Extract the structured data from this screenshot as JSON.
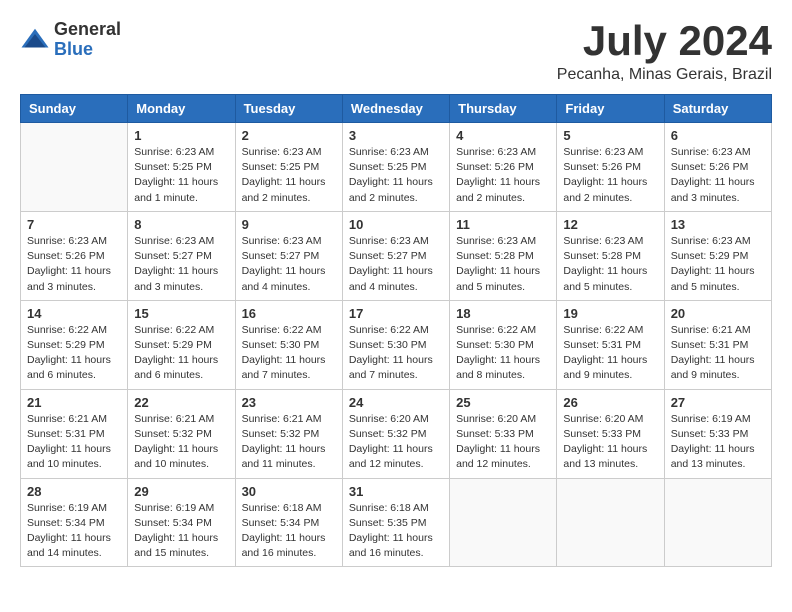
{
  "header": {
    "logo_general": "General",
    "logo_blue": "Blue",
    "month": "July 2024",
    "location": "Pecanha, Minas Gerais, Brazil"
  },
  "days_of_week": [
    "Sunday",
    "Monday",
    "Tuesday",
    "Wednesday",
    "Thursday",
    "Friday",
    "Saturday"
  ],
  "weeks": [
    [
      {
        "day": "",
        "info": ""
      },
      {
        "day": "1",
        "info": "Sunrise: 6:23 AM\nSunset: 5:25 PM\nDaylight: 11 hours\nand 1 minute."
      },
      {
        "day": "2",
        "info": "Sunrise: 6:23 AM\nSunset: 5:25 PM\nDaylight: 11 hours\nand 2 minutes."
      },
      {
        "day": "3",
        "info": "Sunrise: 6:23 AM\nSunset: 5:25 PM\nDaylight: 11 hours\nand 2 minutes."
      },
      {
        "day": "4",
        "info": "Sunrise: 6:23 AM\nSunset: 5:26 PM\nDaylight: 11 hours\nand 2 minutes."
      },
      {
        "day": "5",
        "info": "Sunrise: 6:23 AM\nSunset: 5:26 PM\nDaylight: 11 hours\nand 2 minutes."
      },
      {
        "day": "6",
        "info": "Sunrise: 6:23 AM\nSunset: 5:26 PM\nDaylight: 11 hours\nand 3 minutes."
      }
    ],
    [
      {
        "day": "7",
        "info": "Sunrise: 6:23 AM\nSunset: 5:26 PM\nDaylight: 11 hours\nand 3 minutes."
      },
      {
        "day": "8",
        "info": "Sunrise: 6:23 AM\nSunset: 5:27 PM\nDaylight: 11 hours\nand 3 minutes."
      },
      {
        "day": "9",
        "info": "Sunrise: 6:23 AM\nSunset: 5:27 PM\nDaylight: 11 hours\nand 4 minutes."
      },
      {
        "day": "10",
        "info": "Sunrise: 6:23 AM\nSunset: 5:27 PM\nDaylight: 11 hours\nand 4 minutes."
      },
      {
        "day": "11",
        "info": "Sunrise: 6:23 AM\nSunset: 5:28 PM\nDaylight: 11 hours\nand 5 minutes."
      },
      {
        "day": "12",
        "info": "Sunrise: 6:23 AM\nSunset: 5:28 PM\nDaylight: 11 hours\nand 5 minutes."
      },
      {
        "day": "13",
        "info": "Sunrise: 6:23 AM\nSunset: 5:29 PM\nDaylight: 11 hours\nand 5 minutes."
      }
    ],
    [
      {
        "day": "14",
        "info": "Sunrise: 6:22 AM\nSunset: 5:29 PM\nDaylight: 11 hours\nand 6 minutes."
      },
      {
        "day": "15",
        "info": "Sunrise: 6:22 AM\nSunset: 5:29 PM\nDaylight: 11 hours\nand 6 minutes."
      },
      {
        "day": "16",
        "info": "Sunrise: 6:22 AM\nSunset: 5:30 PM\nDaylight: 11 hours\nand 7 minutes."
      },
      {
        "day": "17",
        "info": "Sunrise: 6:22 AM\nSunset: 5:30 PM\nDaylight: 11 hours\nand 7 minutes."
      },
      {
        "day": "18",
        "info": "Sunrise: 6:22 AM\nSunset: 5:30 PM\nDaylight: 11 hours\nand 8 minutes."
      },
      {
        "day": "19",
        "info": "Sunrise: 6:22 AM\nSunset: 5:31 PM\nDaylight: 11 hours\nand 9 minutes."
      },
      {
        "day": "20",
        "info": "Sunrise: 6:21 AM\nSunset: 5:31 PM\nDaylight: 11 hours\nand 9 minutes."
      }
    ],
    [
      {
        "day": "21",
        "info": "Sunrise: 6:21 AM\nSunset: 5:31 PM\nDaylight: 11 hours\nand 10 minutes."
      },
      {
        "day": "22",
        "info": "Sunrise: 6:21 AM\nSunset: 5:32 PM\nDaylight: 11 hours\nand 10 minutes."
      },
      {
        "day": "23",
        "info": "Sunrise: 6:21 AM\nSunset: 5:32 PM\nDaylight: 11 hours\nand 11 minutes."
      },
      {
        "day": "24",
        "info": "Sunrise: 6:20 AM\nSunset: 5:32 PM\nDaylight: 11 hours\nand 12 minutes."
      },
      {
        "day": "25",
        "info": "Sunrise: 6:20 AM\nSunset: 5:33 PM\nDaylight: 11 hours\nand 12 minutes."
      },
      {
        "day": "26",
        "info": "Sunrise: 6:20 AM\nSunset: 5:33 PM\nDaylight: 11 hours\nand 13 minutes."
      },
      {
        "day": "27",
        "info": "Sunrise: 6:19 AM\nSunset: 5:33 PM\nDaylight: 11 hours\nand 13 minutes."
      }
    ],
    [
      {
        "day": "28",
        "info": "Sunrise: 6:19 AM\nSunset: 5:34 PM\nDaylight: 11 hours\nand 14 minutes."
      },
      {
        "day": "29",
        "info": "Sunrise: 6:19 AM\nSunset: 5:34 PM\nDaylight: 11 hours\nand 15 minutes."
      },
      {
        "day": "30",
        "info": "Sunrise: 6:18 AM\nSunset: 5:34 PM\nDaylight: 11 hours\nand 16 minutes."
      },
      {
        "day": "31",
        "info": "Sunrise: 6:18 AM\nSunset: 5:35 PM\nDaylight: 11 hours\nand 16 minutes."
      },
      {
        "day": "",
        "info": ""
      },
      {
        "day": "",
        "info": ""
      },
      {
        "day": "",
        "info": ""
      }
    ]
  ]
}
